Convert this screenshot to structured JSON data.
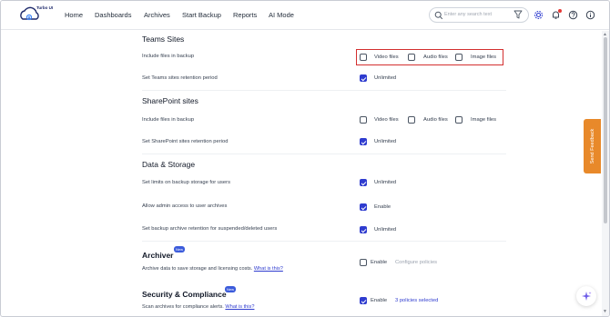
{
  "app": {
    "logo_text": "Turbo UI"
  },
  "nav": {
    "items": [
      {
        "label": "Home"
      },
      {
        "label": "Dashboards"
      },
      {
        "label": "Archives"
      },
      {
        "label": "Start Backup"
      },
      {
        "label": "Reports"
      },
      {
        "label": "AI Mode"
      }
    ]
  },
  "search": {
    "placeholder": "Enter any search text"
  },
  "icons": {
    "logo": "cloud-logo-icon",
    "search": "search-icon",
    "filter": "filter-icon",
    "settings": "gear-icon",
    "notifications": "bell-icon",
    "help": "help-icon",
    "account": "info-icon",
    "ai": "sparkle-icon"
  },
  "colors": {
    "accent": "#2f3ccf",
    "highlight": "#d32f2f",
    "feedback": "#e8892a",
    "notification": "#e53935"
  },
  "teams": {
    "title": "Teams Sites",
    "include_label": "Include files in backup",
    "video": "Video files",
    "audio": "Audio files",
    "image": "Image files",
    "retention_label": "Set Teams sites retention period",
    "retention_value": "Unlimited"
  },
  "sharepoint": {
    "title": "SharePoint sites",
    "include_label": "Include files in backup",
    "video": "Video files",
    "audio": "Audio files",
    "image": "Image files",
    "retention_label": "Set SharePoint sites retention period",
    "retention_value": "Unlimited"
  },
  "data_storage": {
    "title": "Data & Storage",
    "limits_label": "Set limits on backup storage for users",
    "limits_value": "Unlimited",
    "admin_label": "Allow admin access to user archives",
    "admin_value": "Enable",
    "retention_label": "Set backup archive retention for suspended/deleted users",
    "retention_value": "Unlimited"
  },
  "archiver": {
    "title": "Archiver",
    "badge": "New",
    "desc": "Archive data to save storage and licensing costs.",
    "link": "What is this?",
    "enable": "Enable",
    "configure": "Configure policies"
  },
  "security": {
    "title": "Security & Compliance",
    "badge": "New",
    "desc": "Scan archives for compliance alerts.",
    "link": "What is this?",
    "enable": "Enable",
    "policies": "3 policies selected"
  },
  "feedback": {
    "label": "Send Feedback"
  }
}
